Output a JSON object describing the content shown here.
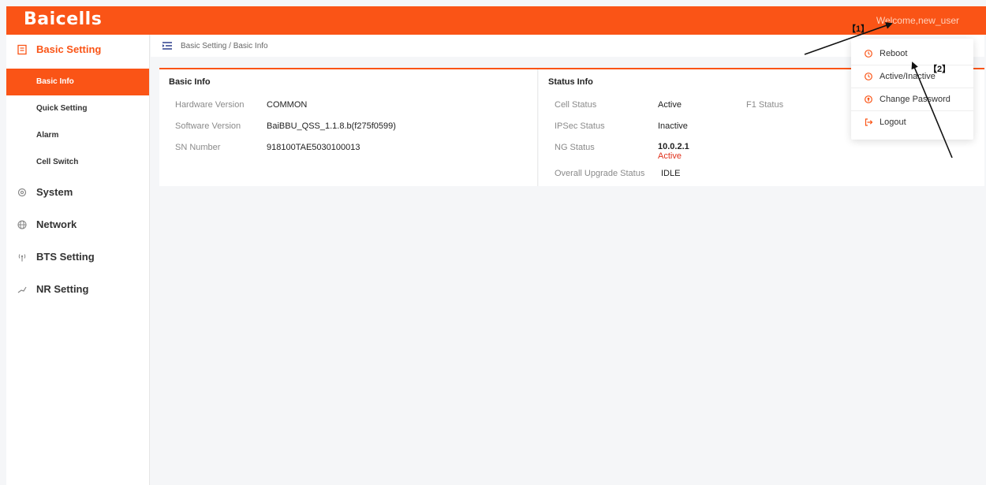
{
  "header": {
    "logo": "Baicells",
    "welcome": "Welcome,new_user"
  },
  "sidebar": {
    "basic_setting": "Basic Setting",
    "sub_items": [
      {
        "label": "Basic Info"
      },
      {
        "label": "Quick Setting"
      },
      {
        "label": "Alarm"
      },
      {
        "label": "Cell Switch"
      }
    ],
    "system": "System",
    "network": "Network",
    "bts_setting": "BTS Setting",
    "nr_setting": "NR Setting"
  },
  "breadcrumb": "Basic Setting / Basic Info",
  "basic_info": {
    "title": "Basic Info",
    "hardware_label": "Hardware Version",
    "hardware_value": "COMMON",
    "software_label": "Software Version",
    "software_value": "BaiBBU_QSS_1.1.8.b(f275f0599)",
    "sn_label": "SN Number",
    "sn_value": "918100TAE5030100013"
  },
  "status_info": {
    "title": "Status Info",
    "cell_label": "Cell Status",
    "cell_value": "Active",
    "f1_label": "F1 Status",
    "ipsec_label": "IPSec Status",
    "ipsec_value": "Inactive",
    "ng_label": "NG Status",
    "ng_ip": "10.0.2.1",
    "ng_state": "Active",
    "upgrade_label": "Overall Upgrade Status",
    "upgrade_value": "IDLE"
  },
  "dropdown": {
    "reboot": "Reboot",
    "active_inactive": "Active/Inactive",
    "change_password": "Change Password",
    "logout": "Logout"
  },
  "annotations": {
    "label_1": "【1】",
    "label_2": "【2】"
  },
  "colors": {
    "brand": "#fa5416",
    "status_red": "#e0311b"
  }
}
